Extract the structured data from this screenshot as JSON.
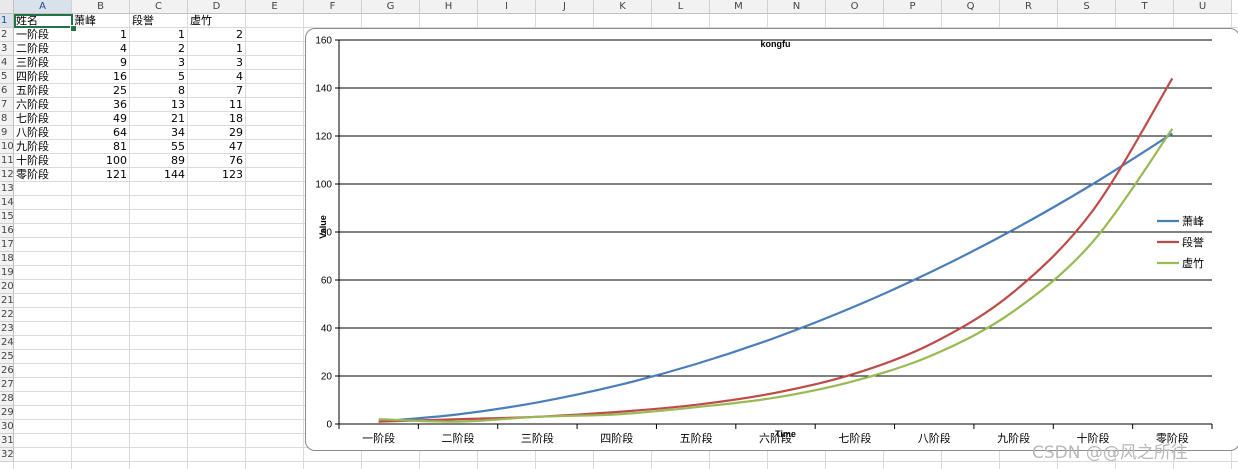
{
  "columns": [
    "A",
    "B",
    "C",
    "D",
    "E",
    "F",
    "G",
    "H",
    "I",
    "J",
    "K",
    "L",
    "M",
    "N",
    "O",
    "P",
    "Q",
    "R",
    "S",
    "T",
    "U"
  ],
  "rows": [
    "1",
    "2",
    "3",
    "4",
    "5",
    "6",
    "7",
    "8",
    "9",
    "10",
    "11",
    "12",
    "13",
    "14",
    "15",
    "16",
    "17",
    "18",
    "19",
    "20",
    "21",
    "22",
    "23",
    "24",
    "25",
    "26",
    "27",
    "28",
    "29",
    "30",
    "31",
    "32"
  ],
  "header": [
    "姓名",
    "萧峰",
    "段誉",
    "虚竹"
  ],
  "table": [
    [
      "一阶段",
      "1",
      "1",
      "2"
    ],
    [
      "二阶段",
      "4",
      "2",
      "1"
    ],
    [
      "三阶段",
      "9",
      "3",
      "3"
    ],
    [
      "四阶段",
      "16",
      "5",
      "4"
    ],
    [
      "五阶段",
      "25",
      "8",
      "7"
    ],
    [
      "六阶段",
      "36",
      "13",
      "11"
    ],
    [
      "七阶段",
      "49",
      "21",
      "18"
    ],
    [
      "八阶段",
      "64",
      "34",
      "29"
    ],
    [
      "九阶段",
      "81",
      "55",
      "47"
    ],
    [
      "十阶段",
      "100",
      "89",
      "76"
    ],
    [
      "零阶段",
      "121",
      "144",
      "123"
    ]
  ],
  "chart_data": {
    "type": "line",
    "title": "kongfu",
    "xlabel": "Time",
    "ylabel": "Value",
    "categories": [
      "一阶段",
      "二阶段",
      "三阶段",
      "四阶段",
      "五阶段",
      "六阶段",
      "七阶段",
      "八阶段",
      "九阶段",
      "十阶段",
      "零阶段"
    ],
    "ylim": [
      0,
      160
    ],
    "yticks": [
      "0",
      "20",
      "40",
      "60",
      "80",
      "100",
      "120",
      "140",
      "160"
    ],
    "grid": true,
    "legend": "right",
    "series": [
      {
        "name": "萧峰",
        "color": "#4a7ebb",
        "values": [
          1,
          4,
          9,
          16,
          25,
          36,
          49,
          64,
          81,
          100,
          121
        ]
      },
      {
        "name": "段誉",
        "color": "#be4b48",
        "values": [
          1,
          2,
          3,
          5,
          8,
          13,
          21,
          34,
          55,
          89,
          144
        ]
      },
      {
        "name": "虚竹",
        "color": "#98b954",
        "values": [
          2,
          1,
          3,
          4,
          7,
          11,
          18,
          29,
          47,
          76,
          123
        ]
      }
    ]
  },
  "watermark": "CSDN @@风之所往"
}
